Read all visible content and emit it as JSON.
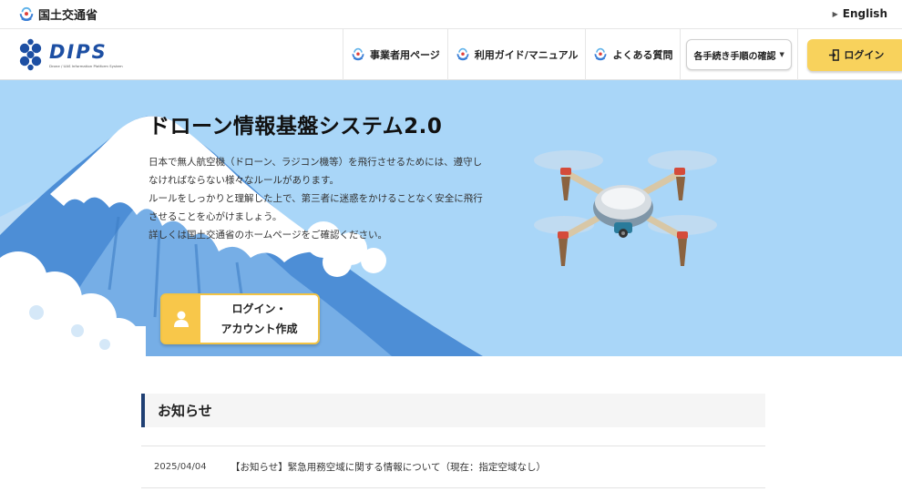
{
  "topbar": {
    "ministry": "国土交通省",
    "language_link": "English"
  },
  "header": {
    "logo_text": "DIPS",
    "logo_subtext": "Drone / UAS Information Platform System",
    "nav": [
      {
        "label": "事業者用ページ",
        "icon": "mlit-emblem-icon"
      },
      {
        "label": "利用ガイド/マニュアル",
        "icon": "mlit-emblem-icon"
      },
      {
        "label": "よくある質問",
        "icon": "mlit-emblem-icon"
      }
    ],
    "procedures_label": "各手続き手順の確認",
    "login_label": "ログイン"
  },
  "hero": {
    "title": "ドローン情報基盤システム2.0",
    "description": [
      "日本で無人航空機（ドローン、ラジコン機等）を飛行させるためには、遵守し",
      "なければならない様々なルールがあります。",
      "ルールをしっかりと理解した上で、第三者に迷惑をかけることなく安全に飛行",
      "させることを心がけましょう。",
      "詳しくは国土交通省のホームページをご確認ください。"
    ],
    "cta_line1": "ログイン・",
    "cta_line2": "アカウント作成"
  },
  "news": {
    "heading": "お知らせ",
    "items": [
      {
        "date": "2025/04/04",
        "title": "【お知らせ】緊急用務空域に関する情報について（現在：指定空域なし）"
      }
    ]
  },
  "colors": {
    "accent_yellow": "#f8d25c",
    "sky": "#a9d6f8",
    "navy": "#1f3f73",
    "logo_blue": "#1d4fa3"
  }
}
